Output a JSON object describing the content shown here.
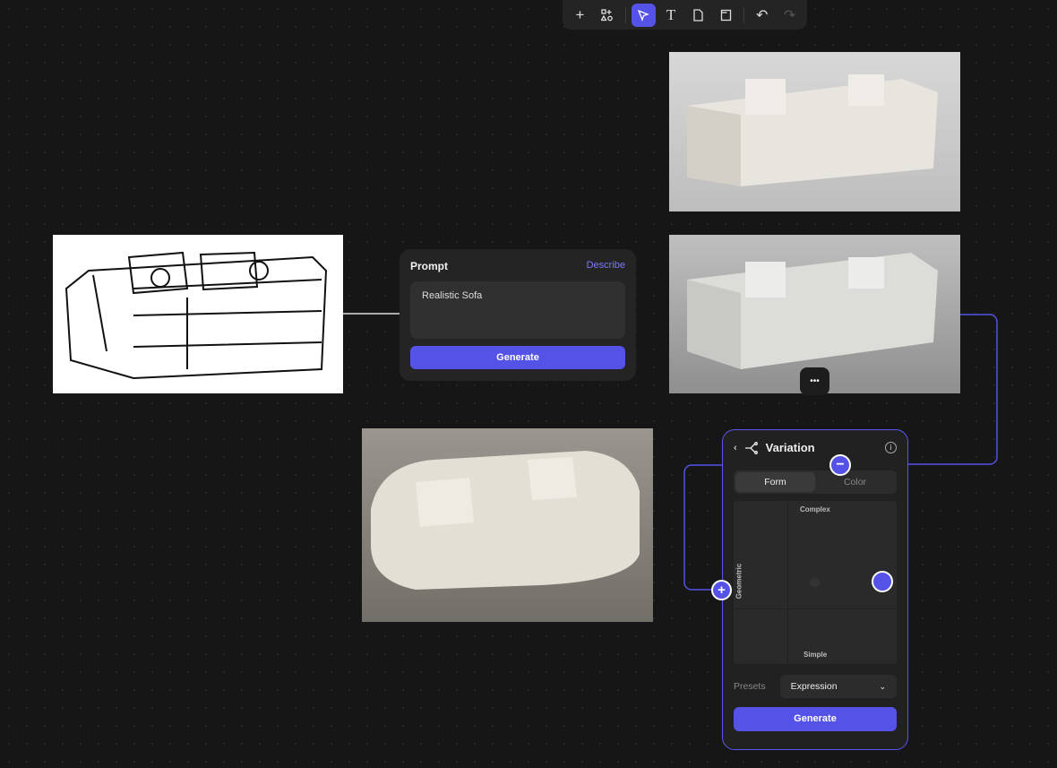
{
  "toolbar": {
    "tools": [
      "add",
      "components",
      "select",
      "text",
      "page",
      "frame",
      "undo",
      "redo"
    ],
    "active": "select"
  },
  "prompt": {
    "title": "Prompt",
    "describe": "Describe",
    "text": "Realistic Sofa",
    "generate": "Generate"
  },
  "more": "•••",
  "variation": {
    "title": "Variation",
    "tabs": [
      "Form",
      "Color"
    ],
    "active_tab": "Form",
    "axis_top": "Complex",
    "axis_bottom": "Simple",
    "axis_left": "Geometric",
    "presets_label": "Presets",
    "preset_value": "Expression",
    "generate": "Generate"
  },
  "colors": {
    "accent": "#5552e8",
    "canvas": "#161616"
  }
}
